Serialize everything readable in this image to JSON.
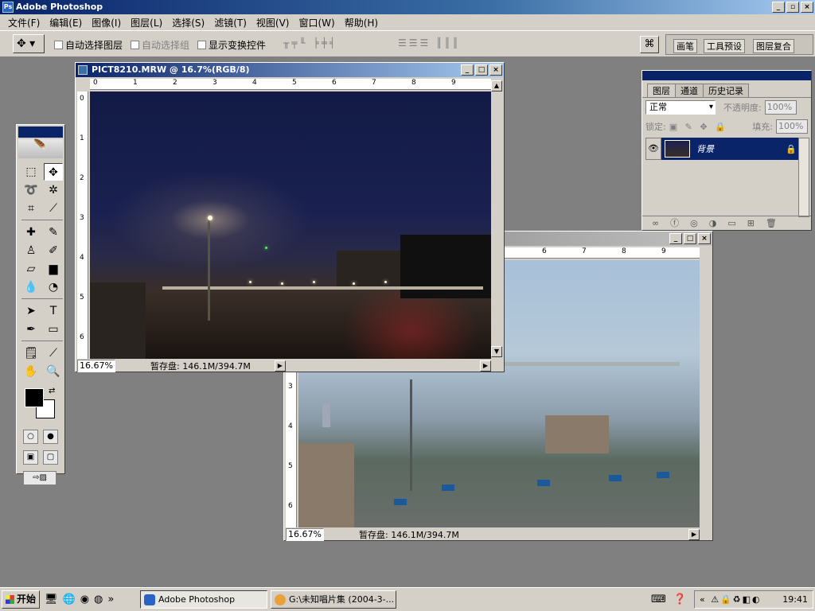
{
  "app": {
    "title": "Adobe Photoshop"
  },
  "menu": [
    "文件(F)",
    "编辑(E)",
    "图像(I)",
    "图层(L)",
    "选择(S)",
    "滤镜(T)",
    "视图(V)",
    "窗口(W)",
    "帮助(H)"
  ],
  "options": {
    "auto_select_layer": "自动选择图层",
    "auto_select_group": "自动选择组",
    "show_transform": "显示变换控件",
    "palette_tabs": [
      "画笔",
      "工具预设",
      "图层复合"
    ]
  },
  "doc1": {
    "title": "PICT8210.MRW @ 16.7%(RGB/8)",
    "h_ruler": [
      "0",
      "1",
      "2",
      "3",
      "4",
      "5",
      "6",
      "7",
      "8",
      "9"
    ],
    "v_ruler": [
      "0",
      "1",
      "2",
      "3",
      "4",
      "5",
      "6"
    ],
    "zoom": "16.67%",
    "scratch": "暂存盘: 146.1M/394.7M"
  },
  "doc2": {
    "h_ruler": [
      "6",
      "7",
      "8",
      "9"
    ],
    "v_ruler": [
      "3",
      "4",
      "5",
      "6"
    ],
    "zoom": "16.67%",
    "scratch": "暂存盘: 146.1M/394.7M"
  },
  "layers_panel": {
    "tabs": [
      "图层",
      "通道",
      "历史记录"
    ],
    "blend_mode": "正常",
    "opacity_label": "不透明度:",
    "opacity_value": "100%",
    "lock_label": "锁定:",
    "fill_label": "填充:",
    "fill_value": "100%",
    "layer_name": "背景"
  },
  "taskbar": {
    "start": "开始",
    "tasks": [
      "Adobe Photoshop",
      "G:\\未知唱片集 (2004-3-..."
    ],
    "clock": "19:41"
  }
}
